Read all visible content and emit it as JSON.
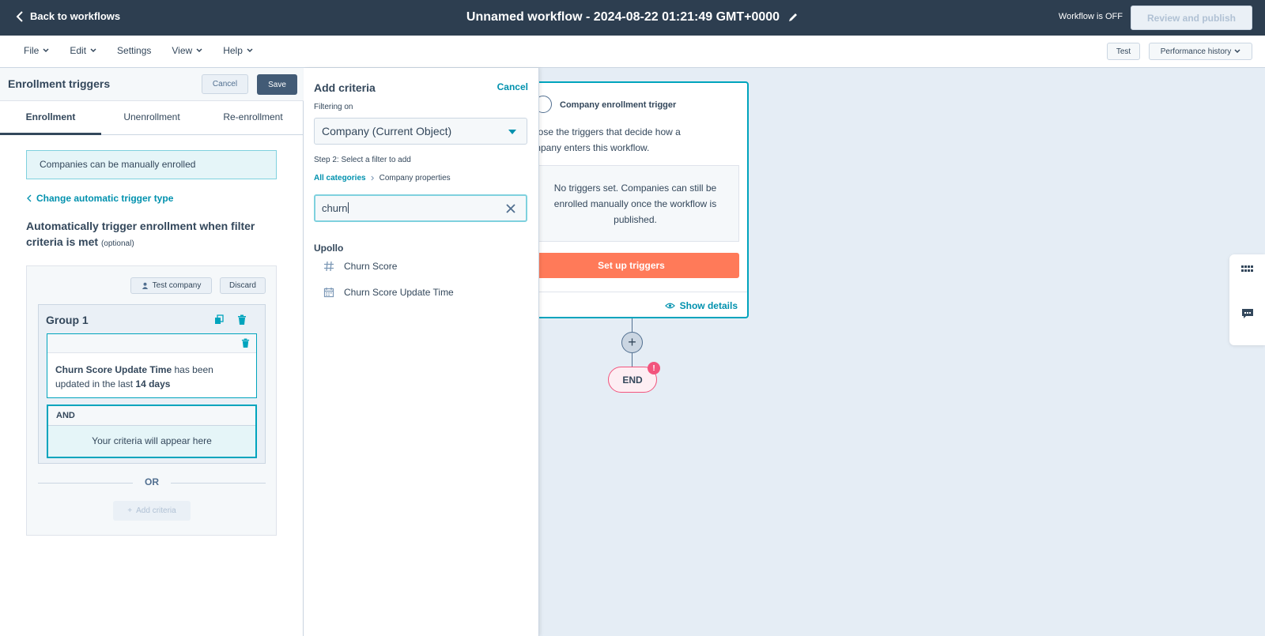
{
  "topbar": {
    "back_label": "Back to workflows",
    "workflow_title": "Unnamed workflow - 2024-08-22 01:21:49 GMT+0000",
    "status": "Workflow is OFF",
    "review_label": "Review and publish"
  },
  "menubar": {
    "items": [
      "File",
      "Edit",
      "Settings",
      "View",
      "Help"
    ],
    "test_label": "Test",
    "performance_label": "Performance history"
  },
  "left_panel": {
    "title": "Enrollment triggers",
    "cancel_label": "Cancel",
    "save_label": "Save",
    "tabs": [
      "Enrollment",
      "Unenrollment",
      "Re-enrollment"
    ],
    "active_tab": "Enrollment",
    "notice": "Companies can be manually enrolled",
    "change_link": "Change automatic trigger type",
    "auto_title": "Automatically trigger enrollment when filter criteria is met",
    "optional": "(optional)",
    "test_company_label": "Test company",
    "discard_label": "Discard",
    "group_title": "Group 1",
    "criterion": {
      "property": "Churn Score Update Time",
      "text_mid": " has been updated in the last ",
      "value": "14 days"
    },
    "and_label": "AND",
    "placeholder_text": "Your criteria will appear here",
    "or_label": "OR",
    "add_criteria_label": "Add criteria"
  },
  "criteria_panel": {
    "title": "Add criteria",
    "cancel_label": "Cancel",
    "filtering_on_label": "Filtering on",
    "object_value": "Company (Current Object)",
    "step_label": "Step 2: Select a filter to add",
    "breadcrumb_root": "All categories",
    "breadcrumb_current": "Company properties",
    "search_value": "churn",
    "result_group": "Upollo",
    "results": [
      {
        "label": "Churn Score",
        "icon": "hash-icon"
      },
      {
        "label": "Churn Score Update Time",
        "icon": "calendar-icon"
      }
    ]
  },
  "canvas": {
    "card_title": "Company enrollment trigger",
    "card_desc": "oose the triggers that decide how a mpany enters this workflow.",
    "card_desc_line1": "oose the triggers that decide how a",
    "card_desc_line2": "mpany enters this workflow.",
    "empty_text": "No triggers set. Companies can still be enrolled manually once the workflow is published.",
    "setup_label": "Set up triggers",
    "show_details_label": "Show details",
    "plus_symbol": "+",
    "end_label": "END",
    "alert_symbol": "!"
  },
  "colors": {
    "topbar": "#2d3e50",
    "accent": "#0091ae",
    "primary_button": "#ff7a59",
    "alert": "#f2547d"
  }
}
